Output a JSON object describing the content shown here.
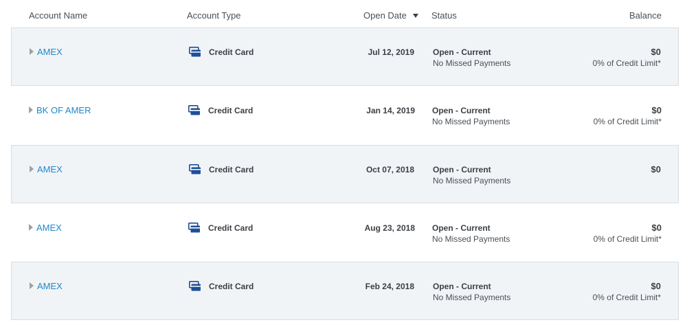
{
  "header": {
    "account_name": "Account Name",
    "account_type": "Account Type",
    "open_date": "Open Date",
    "status": "Status",
    "balance": "Balance"
  },
  "accounts": [
    {
      "name": "AMEX",
      "type": "Credit Card",
      "open_date": "Jul 12, 2019",
      "status": "Open - Current",
      "status_detail": "No Missed Payments",
      "balance": "$0",
      "limit": "0% of Credit Limit*"
    },
    {
      "name": "BK OF AMER",
      "type": "Credit Card",
      "open_date": "Jan 14, 2019",
      "status": "Open - Current",
      "status_detail": "No Missed Payments",
      "balance": "$0",
      "limit": "0% of Credit Limit*"
    },
    {
      "name": "AMEX",
      "type": "Credit Card",
      "open_date": "Oct 07, 2018",
      "status": "Open - Current",
      "status_detail": "No Missed Payments",
      "balance": "$0",
      "limit": ""
    },
    {
      "name": "AMEX",
      "type": "Credit Card",
      "open_date": "Aug 23, 2018",
      "status": "Open - Current",
      "status_detail": "No Missed Payments",
      "balance": "$0",
      "limit": "0% of Credit Limit*"
    },
    {
      "name": "AMEX",
      "type": "Credit Card",
      "open_date": "Feb 24, 2018",
      "status": "Open - Current",
      "status_detail": "No Missed Payments",
      "balance": "$0",
      "limit": "0% of Credit Limit*"
    }
  ],
  "icons": {
    "sort": "sort-descending-icon",
    "expand": "chevron-right-icon",
    "card": "credit-card-icon"
  },
  "colors": {
    "link": "#1f87c9",
    "card_icon": "#1f4e96",
    "shaded_row": "#f1f4f7"
  }
}
